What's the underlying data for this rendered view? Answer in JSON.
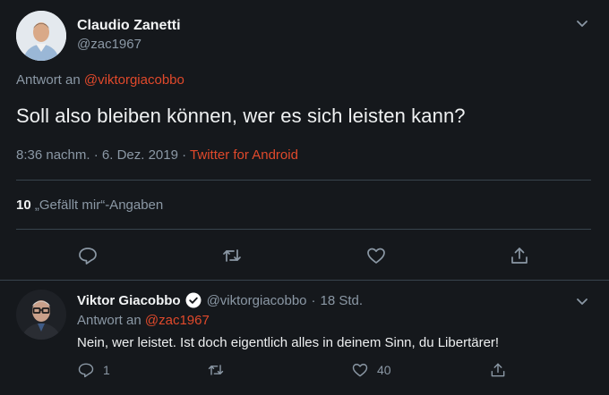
{
  "main_tweet": {
    "author_name": "Claudio Zanetti",
    "author_handle": "@zac1967",
    "reply_prefix": "Antwort an",
    "reply_handle": "@viktorgiacobbo",
    "text": "Soll also bleiben können, wer es sich leisten kann?",
    "time": "8:36 nachm.",
    "separator": "·",
    "date": "6. Dez. 2019",
    "source": "Twitter for Android",
    "likes_count": "10",
    "likes_label": "„Gefällt mir“-Angaben"
  },
  "reply_tweet": {
    "author_name": "Viktor Giacobbo",
    "author_handle": "@viktorgiacobbo",
    "separator": "·",
    "age": "18 Std.",
    "reply_prefix": "Antwort an",
    "reply_handle": "@zac1967",
    "text": "Nein, wer leistet. Ist doch eigentlich alles in deinem Sinn, du Libertärer!",
    "reply_count": "1",
    "like_count": "40"
  },
  "colors": {
    "background": "#15181c",
    "accent": "#e0492b",
    "muted": "#8b98a5",
    "divider": "#38444d",
    "verified": "#ffffff"
  },
  "icons": [
    "chevron-down-icon",
    "reply-icon",
    "retweet-icon",
    "like-icon",
    "share-icon",
    "verified-icon"
  ]
}
